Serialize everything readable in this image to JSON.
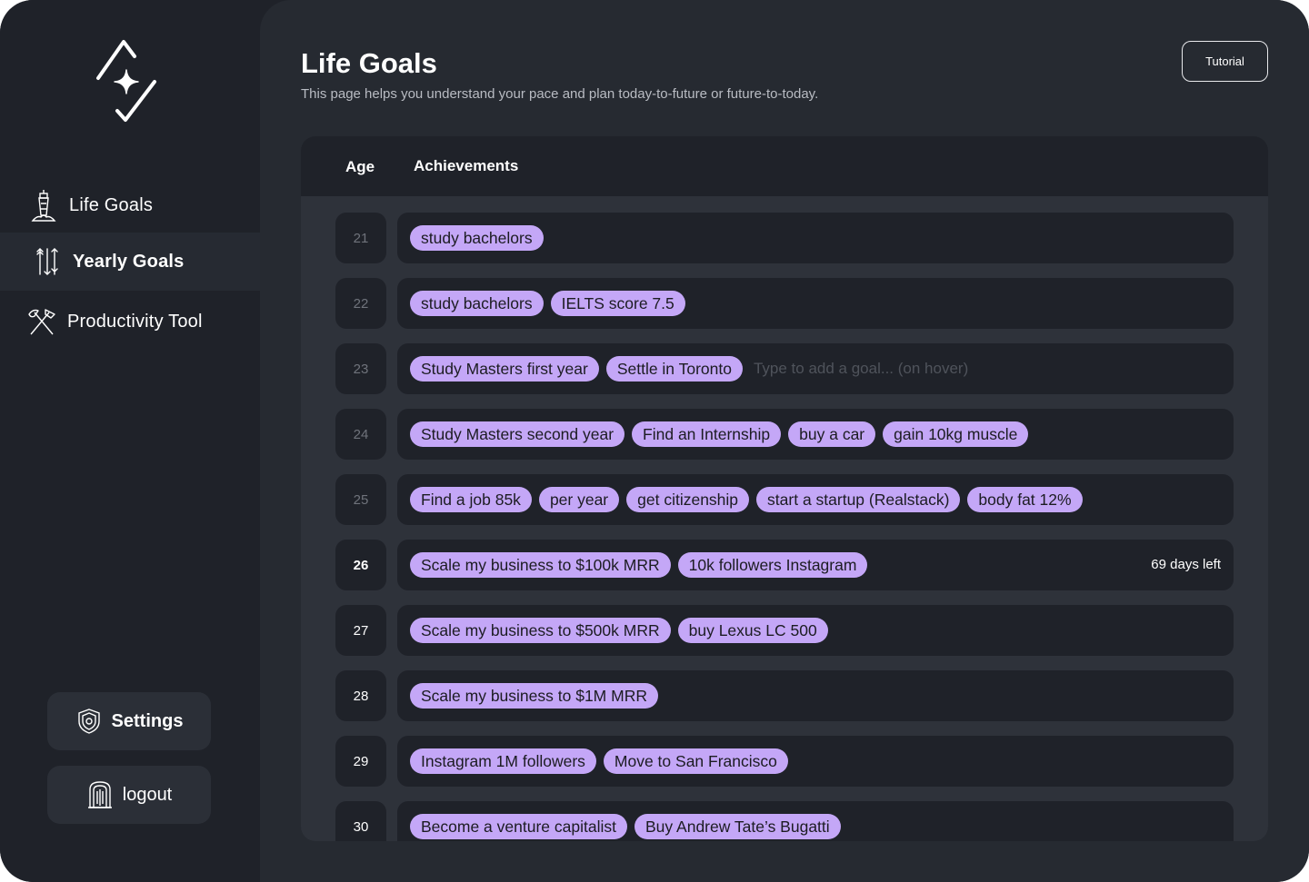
{
  "sidebar": {
    "nav": [
      {
        "label": "Life Goals",
        "icon": "lighthouse-icon",
        "active": false
      },
      {
        "label": "Yearly Goals",
        "icon": "arrows-icon",
        "active": true
      },
      {
        "label": "Productivity Tool",
        "icon": "crossed-tools-icon",
        "active": false
      }
    ],
    "settings_label": "Settings",
    "logout_label": "logout"
  },
  "header": {
    "title": "Life Goals",
    "subtitle": "This page helps you understand your pace and plan today-to-future or future-to-today.",
    "tutorial_label": "Tutorial"
  },
  "table": {
    "col_age": "Age",
    "col_achievements": "Achievements",
    "input_placeholder": "Type to add a goal... (on hover)",
    "days_left": "69 days left",
    "rows": [
      {
        "age": "21",
        "goals": [
          "study bachelors"
        ]
      },
      {
        "age": "22",
        "goals": [
          "study bachelors",
          "IELTS score 7.5"
        ]
      },
      {
        "age": "23",
        "goals": [
          "Study Masters first year",
          "Settle in Toronto"
        ]
      },
      {
        "age": "24",
        "goals": [
          "Study Masters second year",
          "Find an Internship",
          "buy a car",
          "gain 10kg muscle"
        ]
      },
      {
        "age": "25",
        "goals": [
          "Find a job 85k",
          "per year",
          "get citizenship",
          "start a startup (Realstack)",
          "body fat 12%"
        ]
      },
      {
        "age": "26",
        "goals": [
          "Scale my business to $100k MRR",
          "10k followers Instagram"
        ]
      },
      {
        "age": "27",
        "goals": [
          "Scale my business to $500k MRR",
          "buy Lexus LC 500"
        ]
      },
      {
        "age": "28",
        "goals": [
          "Scale my business to $1M MRR"
        ]
      },
      {
        "age": "29",
        "goals": [
          "Instagram 1M followers",
          "Move to San Francisco"
        ]
      },
      {
        "age": "30",
        "goals": [
          "Become a venture capitalist",
          "Buy Andrew Tate’s  Bugatti"
        ]
      }
    ]
  },
  "colors": {
    "background": "#1f2229",
    "panel": "#2e323a",
    "chip": "#c4a7f7",
    "chip_text": "#1c1c22"
  }
}
